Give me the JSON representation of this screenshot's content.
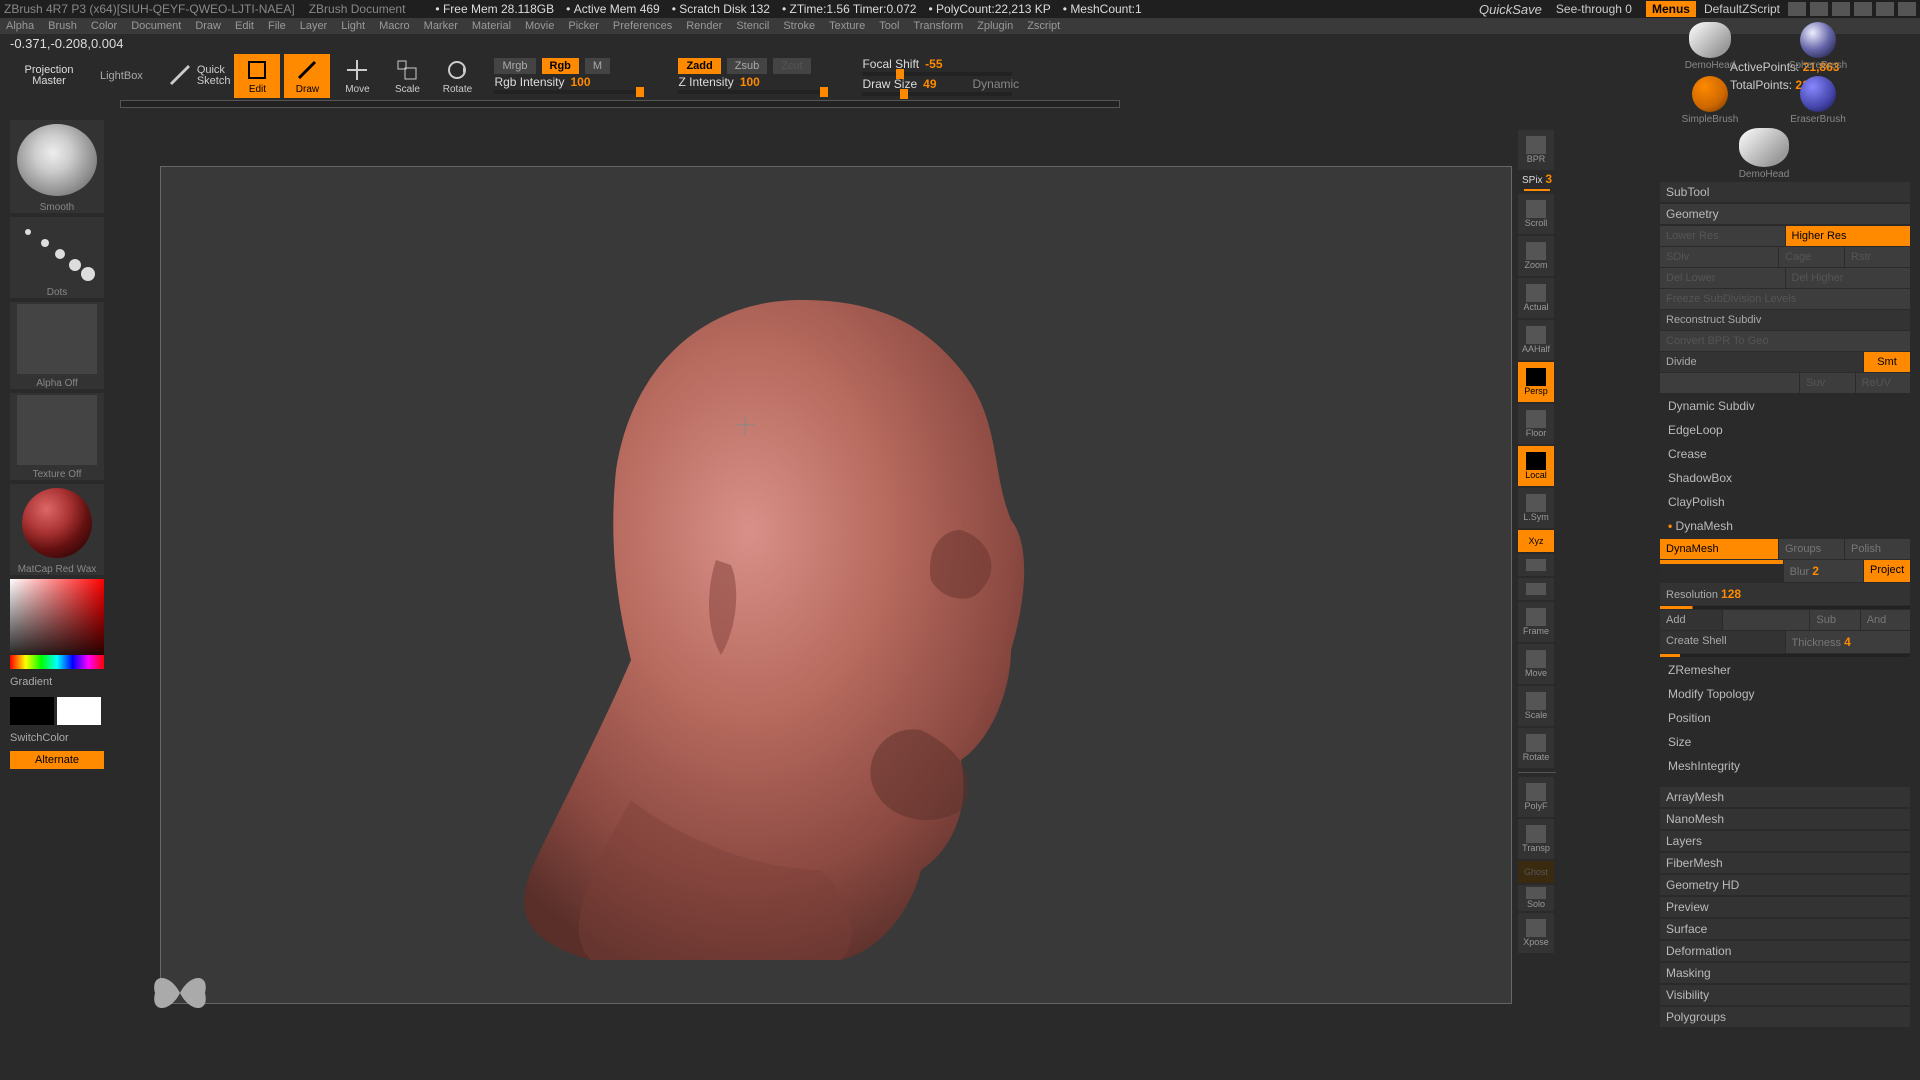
{
  "titlebar": {
    "app": "ZBrush 4R7 P3 (x64)[SIUH-QEYF-QWEO-LJTI-NAEA]",
    "doc": "ZBrush Document",
    "status": {
      "free_mem": "Free Mem 28.118GB",
      "active_mem": "Active Mem 469",
      "scratch": "Scratch Disk 132",
      "ztime": "ZTime:1.56 Timer:0.072",
      "polycount": "PolyCount:22,213 KP",
      "meshcount": "MeshCount:1"
    },
    "quicksave": "QuickSave",
    "seethrough": "See-through   0",
    "menus": "Menus",
    "defaultzscript": "DefaultZScript"
  },
  "menu": [
    "Alpha",
    "Brush",
    "Color",
    "Document",
    "Draw",
    "Edit",
    "File",
    "Layer",
    "Light",
    "Macro",
    "Marker",
    "Material",
    "Movie",
    "Picker",
    "Preferences",
    "Render",
    "Stencil",
    "Stroke",
    "Texture",
    "Tool",
    "Transform",
    "Zplugin",
    "Zscript"
  ],
  "coord": "-0.371,-0.208,0.004",
  "toolbar": {
    "projection": "Projection",
    "master": "Master",
    "lightbox": "LightBox",
    "quicksketch": "Quick Sketch",
    "edit": "Edit",
    "draw": "Draw",
    "move": "Move",
    "scale": "Scale",
    "rotate": "Rotate",
    "mrgb": "Mrgb",
    "rgb": "Rgb",
    "m": "M",
    "zadd": "Zadd",
    "zsub": "Zsub",
    "zcut": "Zcut",
    "rgb_int_label": "Rgb Intensity",
    "rgb_int_val": "100",
    "z_int_label": "Z Intensity",
    "z_int_val": "100",
    "focal_label": "Focal Shift",
    "focal_val": "-55",
    "draw_label": "Draw Size",
    "draw_val": "49",
    "dynamic": "Dynamic",
    "activepoints_label": "ActivePoints:",
    "activepoints_val": "21,863",
    "totalpoints_label": "TotalPoints:",
    "totalpoints_val": "21,863"
  },
  "left": {
    "brush": "Smooth",
    "stroke": "Dots",
    "alpha": "Alpha Off",
    "texture": "Texture Off",
    "material": "MatCap Red Wax",
    "gradient": "Gradient",
    "switchcolor": "SwitchColor",
    "alternate": "Alternate"
  },
  "rightcol": {
    "spix_label": "SPix",
    "spix_val": "3",
    "items": [
      "BPR",
      "Scroll",
      "Zoom",
      "Actual",
      "AAHalf",
      "Persp",
      "Floor",
      "Local",
      "L.Sym",
      "Xyz",
      "",
      "",
      "Frame",
      "Move",
      "Scale",
      "Rotate",
      "PolyF",
      "Transp",
      "Ghost",
      "Solo",
      "Xpose"
    ]
  },
  "tool": {
    "thumbs": {
      "demohead": "DemoHead",
      "spherebrush": "SphereBrush",
      "simplebrush": "SimpleBrush",
      "eraserbrush": "EraserBrush",
      "demohead2": "DemoHead"
    },
    "subtool": "SubTool",
    "geometry": "Geometry",
    "lower_res": "Lower Res",
    "higher_res": "Higher Res",
    "sdiv": "SDiv",
    "cage": "Cage",
    "rsft": "Rstr",
    "del_lower": "Del Lower",
    "del_higher": "Del Higher",
    "freeze": "Freeze SubDivision Levels",
    "reconstruct": "Reconstruct Subdiv",
    "convert": "Convert BPR To Geo",
    "divide": "Divide",
    "smt": "Smt",
    "suv": "Suv",
    "resh": "ReUV",
    "dynamic_subdiv": "Dynamic Subdiv",
    "edgeloop": "EdgeLoop",
    "crease": "Crease",
    "shadowbox": "ShadowBox",
    "claypolish": "ClayPolish",
    "dynamesh_head": "DynaMesh",
    "dynamesh_btn": "DynaMesh",
    "groups": "Groups",
    "polish": "Polish",
    "blur_label": "Blur",
    "blur_val": "2",
    "project": "Project",
    "resolution_label": "Resolution",
    "resolution_val": "128",
    "sub": "Sub",
    "and": "And",
    "add": "Add",
    "createshell": "Create Shell",
    "thickness_label": "Thickness",
    "thickness_val": "4",
    "zremesher": "ZRemesher",
    "modifytopo": "Modify Topology",
    "position": "Position",
    "size": "Size",
    "meshintegrity": "MeshIntegrity",
    "sections": [
      "ArrayMesh",
      "NanoMesh",
      "Layers",
      "FiberMesh",
      "Geometry HD",
      "Preview",
      "Surface",
      "Deformation",
      "Masking",
      "Visibility",
      "Polygroups"
    ]
  }
}
